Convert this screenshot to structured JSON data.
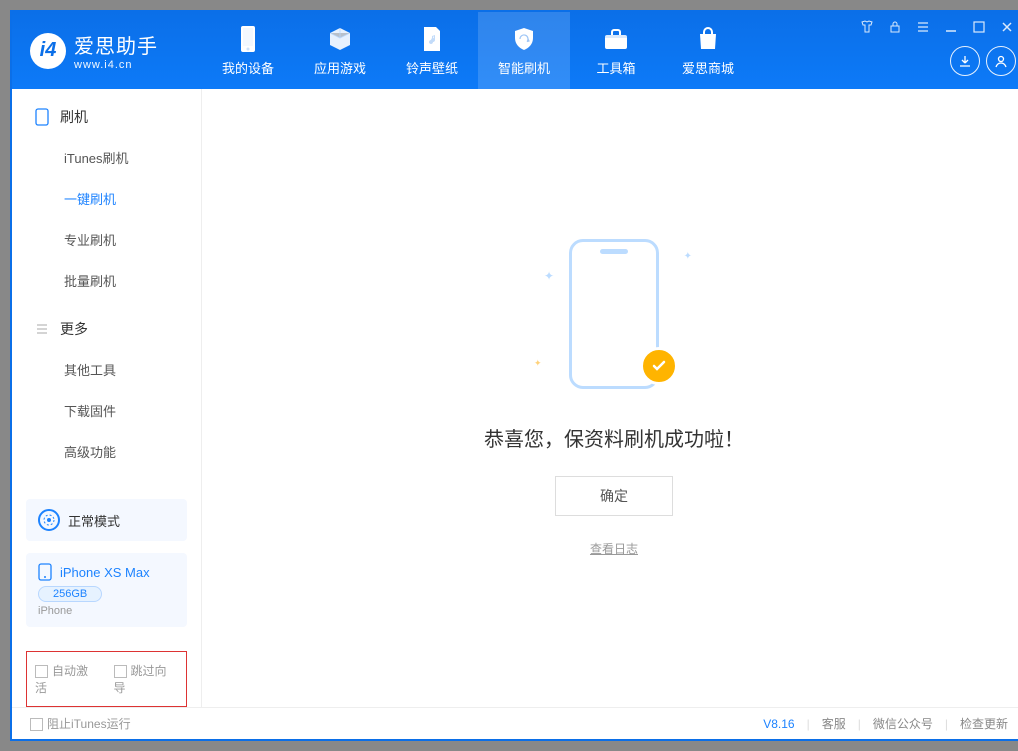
{
  "logo": {
    "cn": "爱思助手",
    "en": "www.i4.cn"
  },
  "tabs": [
    {
      "label": "我的设备"
    },
    {
      "label": "应用游戏"
    },
    {
      "label": "铃声壁纸"
    },
    {
      "label": "智能刷机"
    },
    {
      "label": "工具箱"
    },
    {
      "label": "爱思商城"
    }
  ],
  "sidebar": {
    "section1_title": "刷机",
    "section1_items": [
      {
        "label": "iTunes刷机"
      },
      {
        "label": "一键刷机"
      },
      {
        "label": "专业刷机"
      },
      {
        "label": "批量刷机"
      }
    ],
    "section2_title": "更多",
    "section2_items": [
      {
        "label": "其他工具"
      },
      {
        "label": "下载固件"
      },
      {
        "label": "高级功能"
      }
    ],
    "mode_label": "正常模式",
    "device_name": "iPhone XS Max",
    "device_capacity": "256GB",
    "device_type": "iPhone",
    "cb_auto_activate": "自动激活",
    "cb_skip_guide": "跳过向导"
  },
  "main": {
    "success_title": "恭喜您，保资料刷机成功啦！",
    "ok_button": "确定",
    "view_log": "查看日志"
  },
  "statusbar": {
    "stop_itunes": "阻止iTunes运行",
    "version": "V8.16",
    "support": "客服",
    "wechat": "微信公众号",
    "check_update": "检查更新"
  }
}
